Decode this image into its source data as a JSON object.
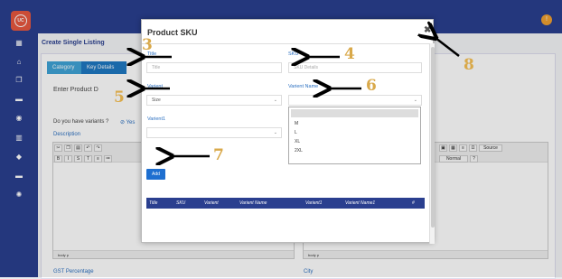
{
  "brand": {
    "logo_text": "UC",
    "accent": "#2a3f8f"
  },
  "header": {
    "user_initial": "!"
  },
  "sidebar": {
    "icons": [
      "dashboard-icon",
      "bag-icon",
      "copy-icon",
      "truck-icon",
      "database-icon",
      "chart-icon",
      "tag-icon",
      "truck-icon",
      "settings-icon"
    ]
  },
  "page": {
    "title": "Create Single Listing",
    "tabs": [
      {
        "label": "Category"
      },
      {
        "label": "Key Details"
      }
    ],
    "enter_product": "Enter Product D",
    "variants_question": "Do you have variants ?",
    "variants_yes": "Yes",
    "description_label": "Description",
    "editor_footer": "body p",
    "editor_source": "Source",
    "editor_normal": "Normal",
    "gst_label": "GST Percentage",
    "city_label": "City"
  },
  "modal": {
    "title": "Product SKU",
    "close": "✖",
    "fields": {
      "title_label": "Title",
      "title_placeholder": "Title",
      "sku_label": "SKU",
      "sku_placeholder": "SKU Details",
      "varient_label": "Varient",
      "varient_value": "Size",
      "varient_name_label": "Varient Name",
      "varient1_label": "Varient1"
    },
    "dropdown_options": [
      "",
      "M",
      "L",
      "XL",
      "2XL"
    ],
    "add_label": "Add",
    "table_headers": [
      "Title",
      "SKU",
      "Varient",
      "Varient Name",
      "Varient1",
      "Varient Name1",
      "#"
    ]
  },
  "annotations": [
    "3",
    "4",
    "5",
    "6",
    "7",
    "8"
  ]
}
